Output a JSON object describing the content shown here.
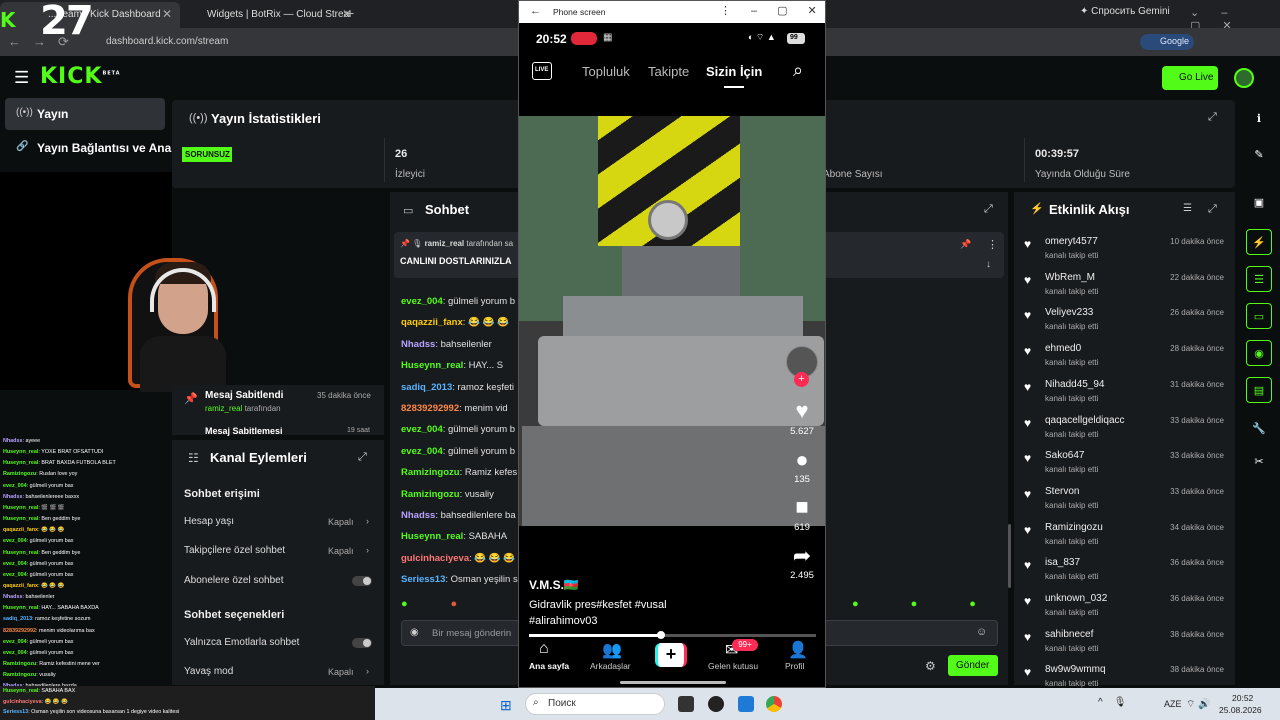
{
  "browser": {
    "tab1_title": "...tream | Kick Dashboard",
    "tab2_title": "Widgets | BotRix — Cloud Strea",
    "new_tab": "+",
    "gemini_label": "Спросить Gemini",
    "url": "dashboard.kick.com/stream",
    "google_label": "Google",
    "overlay_number": "27"
  },
  "header": {
    "logo": "KICK",
    "logo_sup": "BETA",
    "go_live": "Go Live"
  },
  "nav": {
    "items": [
      {
        "label": "Yayın"
      },
      {
        "label": "Yayın Bağlantısı ve Anahtarı"
      }
    ]
  },
  "stats": {
    "title": "Yayın İstatistikleri",
    "status": "SORUNSUZ",
    "viewers_value": "26",
    "viewers_label": "İzleyici",
    "subs_label": "Abone Sayısı",
    "duration_value": "00:39:57",
    "duration_label": "Yayında Olduğu Süre"
  },
  "pinned": {
    "title": "Mesaj Sabitlendi",
    "time": "35 dakika önce",
    "by_user": "ramiz_real",
    "by_suffix": " tarafından",
    "unpinned_title": "Mesaj Sabitlemesi",
    "unpinned_time": "19 saat"
  },
  "channel_actions": {
    "title": "Kanal Eylemleri",
    "section1": "Sohbet erişimi",
    "opt1": "Hesap yaşı",
    "opt1_val": "Kapalı",
    "opt2": "Takipçilere özel sohbet",
    "opt2_val": "Kapalı",
    "opt3": "Abonelere özel sohbet",
    "section2": "Sohbet seçenekleri",
    "opt4": "Yalnızca Emotlarla sohbet",
    "opt5": "Yavaş mod",
    "opt5_val": "Kapalı"
  },
  "overlay_chat": [
    {
      "user": "Nhadss",
      "text": ": ayeee",
      "color": "#b8a2ff"
    },
    {
      "user": "Huseynn_real",
      "text": ": YOXE BRAT OFSATTUDI",
      "color": "#53fc18"
    },
    {
      "user": "Huseynn_real",
      "text": ": BRAT BAXDA FUTBOLA BLET",
      "color": "#53fc18"
    },
    {
      "user": "Ramizingozu",
      "text": ": Ruslan love yoy",
      "color": "#53fc18"
    },
    {
      "user": "evez_004",
      "text": ": gülmeli yorum bax",
      "color": "#53fc18"
    },
    {
      "user": "Nhadss",
      "text": ": bahseilenlereee baxxx",
      "color": "#b8a2ff"
    },
    {
      "user": "Huseynn_real",
      "text": ": 🎬 🎬 🎬",
      "color": "#53fc18"
    },
    {
      "user": "Huseynn_real",
      "text": ": Ben geddim bye",
      "color": "#53fc18"
    },
    {
      "user": "qaqazzii_fanx",
      "text": ": 😂 😂 😂",
      "color": "#ffcc00"
    },
    {
      "user": "evez_004",
      "text": ": gülmeli yorum bax",
      "color": "#53fc18"
    },
    {
      "user": "Huseynn_real",
      "text": ": Ben geddim bye",
      "color": "#53fc18"
    },
    {
      "user": "evez_004",
      "text": ": gülmeli yorum bax",
      "color": "#53fc18"
    },
    {
      "user": "evez_004",
      "text": ": gülmeli yorum bax",
      "color": "#53fc18"
    },
    {
      "user": "qaqazzii_fanx",
      "text": ": 😂 😂 😂",
      "color": "#ffcc00"
    },
    {
      "user": "Nhadss",
      "text": ": bahseilenler",
      "color": "#b8a2ff"
    },
    {
      "user": "Huseynn_real",
      "text": ": HAY... SABAHA BAXDA",
      "color": "#53fc18"
    },
    {
      "user": "sadiq_2013",
      "text": ": ramoz keşfetine sozum",
      "color": "#5ab4ff"
    },
    {
      "user": "82839292992",
      "text": ": menim videolarıma bax",
      "color": "#ff8844"
    },
    {
      "user": "evez_004",
      "text": ": gülmeli yorum bax",
      "color": "#53fc18"
    },
    {
      "user": "evez_004",
      "text": ": gülmeli yorum bax",
      "color": "#53fc18"
    },
    {
      "user": "Ramizingozu",
      "text": ": Ramiz kefestini mene ver",
      "color": "#53fc18"
    },
    {
      "user": "Ramizingozu",
      "text": ": vusaliy",
      "color": "#53fc18"
    },
    {
      "user": "Nhadss",
      "text": ": bahsedilenlere bazda",
      "color": "#b8a2ff"
    }
  ],
  "overlay_bottom": [
    {
      "user": "Huseynn_real",
      "text": ": SABAHA BAX",
      "color": "#53fc18"
    },
    {
      "user": "gulcinhaciyeva",
      "text": ": 😂 😂 😂",
      "color": "#ff7777"
    },
    {
      "user": "Seriess13",
      "text": ": Osman yeşilin son videosuna baxarsan 1 degiye video kalitesi",
      "color": "#5ab4ff"
    }
  ],
  "chat": {
    "title": "Sohbet",
    "pinned_by_user": "ramiz_real",
    "pinned_by_suffix": " tarafından sa",
    "pinned_text": "CANLINI DOSTLARINIZLA",
    "messages": [
      {
        "user": "evez_004",
        "text": ": gülmeli yorum b",
        "color": "#53fc18"
      },
      {
        "user": "qaqazzii_fanx",
        "text": ": 😂 😂 😂",
        "color": "#ffcc00"
      },
      {
        "user": "Nhadss",
        "text": ": bahseilenler",
        "color": "#b8a2ff"
      },
      {
        "user": "Huseynn_real",
        "text": ": HAY... S",
        "color": "#53fc18"
      },
      {
        "user": "sadiq_2013",
        "text": ": ramoz keşfeti",
        "color": "#5ab4ff"
      },
      {
        "user": "82839292992",
        "text": ": menim vid",
        "color": "#ff8844"
      },
      {
        "user": "evez_004",
        "text": ": gülmeli yorum b",
        "color": "#53fc18"
      },
      {
        "user": "evez_004",
        "text": ": gülmeli yorum b",
        "color": "#53fc18"
      },
      {
        "user": "Ramizingozu",
        "text": ": Ramiz kefes",
        "color": "#53fc18"
      },
      {
        "user": "Ramizingozu",
        "text": ": vusaliy",
        "color": "#53fc18"
      },
      {
        "user": "Nhadss",
        "text": ": bahsedilenlere ba",
        "color": "#b8a2ff"
      },
      {
        "user": "Huseynn_real",
        "text": ": SABAHA",
        "color": "#53fc18"
      },
      {
        "user": "gulcinhaciyeva",
        "text": ": 😂 😂 😂",
        "color": "#ff7777"
      },
      {
        "user": "Seriess13",
        "text": ": Osman yeşilin s",
        "color": "#5ab4ff"
      }
    ],
    "placeholder": "Bir mesaj gönderin",
    "send": "Gönder"
  },
  "activity": {
    "title": "Etkinlik Akışı",
    "sub": "kanalı takip etti",
    "items": [
      {
        "name": "omeryt4577",
        "time": "10 dakika önce"
      },
      {
        "name": "WbRem_M",
        "time": "22 dakika önce"
      },
      {
        "name": "Veliyev233",
        "time": "26 dakika önce"
      },
      {
        "name": "ehmed0",
        "time": "28 dakika önce"
      },
      {
        "name": "Nihadd45_94",
        "time": "31 dakika önce"
      },
      {
        "name": "qaqacellgeldiqacc",
        "time": "33 dakika önce"
      },
      {
        "name": "Sako647",
        "time": "33 dakika önce"
      },
      {
        "name": "Stervon",
        "time": "33 dakika önce"
      },
      {
        "name": "Ramizingozu",
        "time": "34 dakika önce"
      },
      {
        "name": "isa_837",
        "time": "36 dakika önce"
      },
      {
        "name": "unknown_032",
        "time": "36 dakika önce"
      },
      {
        "name": "sahibnecef",
        "time": "38 dakika önce"
      },
      {
        "name": "8w9w9wmmq",
        "time": "38 dakika önce"
      }
    ]
  },
  "phone": {
    "window_title": "Phone screen",
    "time": "20:52",
    "battery": "99",
    "live": "LIVE",
    "tabs": [
      "Topluluk",
      "Takipte",
      "Sizin İçin"
    ],
    "likes": "5.627",
    "comments": "135",
    "saves": "619",
    "shares": "2.495",
    "user": "V.M.S.🇦🇿",
    "desc_line1": "Gidravlik pres#kesfet #vusal",
    "desc_line2": "#alirahimov03",
    "progress": 0.46,
    "nav": [
      "Ana sayfa",
      "Arkadaşlar",
      "",
      "Gelen kutusu",
      "Profil"
    ],
    "inbox_badge": "99+"
  },
  "taskbar": {
    "search": "Поиск",
    "lang": "AZE",
    "time": "20:52",
    "date": "25.08.2026"
  }
}
